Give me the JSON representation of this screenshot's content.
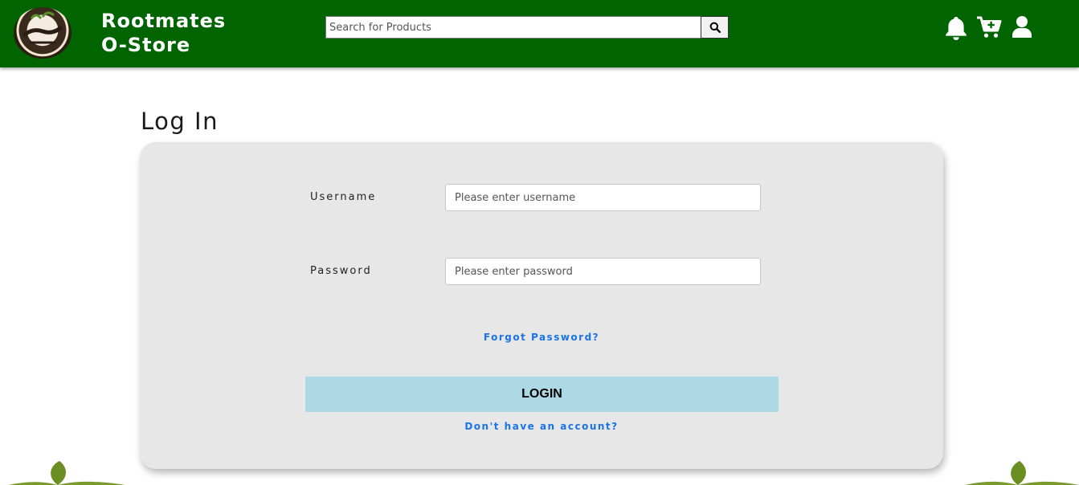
{
  "header": {
    "logo_alt": "Rootmates",
    "brand_line1": "Rootmates",
    "brand_line2": "O-Store",
    "search_placeholder": "Search for Products",
    "search_value": "",
    "icons": [
      "bell-icon",
      "cart-plus-icon",
      "user-icon"
    ]
  },
  "page": {
    "title": "Log In"
  },
  "login_form": {
    "username_label": "Username",
    "username_placeholder": "Please enter username",
    "password_label": "Password",
    "password_placeholder": "Please enter password",
    "forgot_link": "Forgot Password?",
    "login_button": "LOGIN",
    "signup_link": "Don't have an account?"
  },
  "colors": {
    "header_bg": "#006400",
    "card_bg": "#e7e7e7",
    "login_button_bg": "#add8e6",
    "link": "#1a73e8",
    "leaf": "#6b8e23"
  }
}
